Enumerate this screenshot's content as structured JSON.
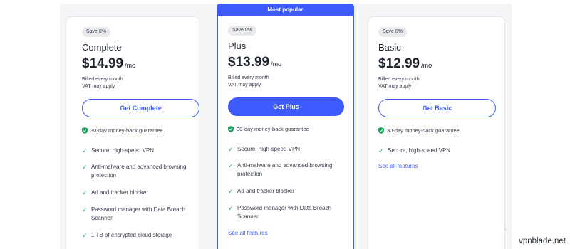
{
  "plans": [
    {
      "badge": "Save 0%",
      "name": "Complete",
      "price": "$14.99",
      "per": "/mo",
      "billing_line1": "Billed every month",
      "billing_line2": "VAT may apply",
      "button": "Get Complete",
      "guarantee": "30-day money-back guarantee",
      "features": [
        "Secure, high-speed VPN",
        "Anti-malware and advanced browsing protection",
        "Ad and tracker blocker",
        "Password manager with Data Breach Scanner",
        "1 TB of encrypted cloud storage"
      ]
    },
    {
      "popular": "Most popular",
      "badge": "Save 0%",
      "name": "Plus",
      "price": "$13.99",
      "per": "/mo",
      "billing_line1": "Billed every month",
      "billing_line2": "VAT may apply",
      "button": "Get Plus",
      "guarantee": "30-day money-back guarantee",
      "features": [
        "Secure, high-speed VPN",
        "Anti-malware and advanced browsing protection",
        "Ad and tracker blocker",
        "Password manager with Data Breach Scanner"
      ],
      "see_all": "See all features"
    },
    {
      "badge": "Save 0%",
      "name": "Basic",
      "price": "$12.99",
      "per": "/mo",
      "billing_line1": "Billed every month",
      "billing_line2": "VAT may apply",
      "button": "Get Basic",
      "guarantee": "30-day money-back guarantee",
      "features": [
        "Secure, high-speed VPN"
      ],
      "see_all": "See all features"
    }
  ],
  "watermark": "vpnblade.net",
  "edge_mark": "A",
  "colors": {
    "accent": "#3d5afe",
    "check": "#1aa45f",
    "background": "#f4f5f7"
  },
  "icons": {
    "shield": "shield-check-icon",
    "check": "checkmark-icon"
  }
}
